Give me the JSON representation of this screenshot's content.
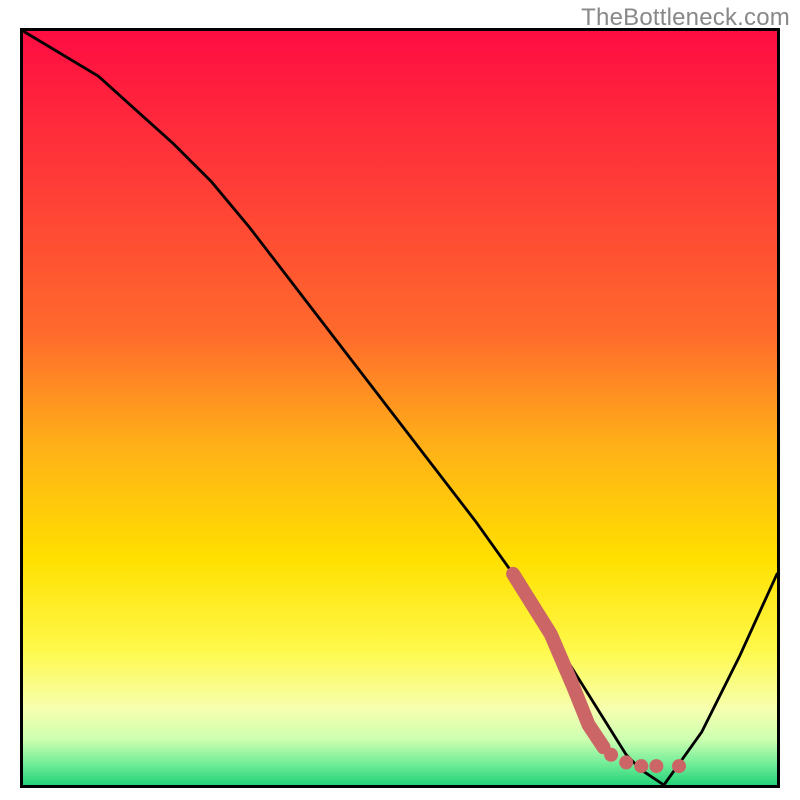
{
  "watermark": "TheBottleneck.com",
  "chart_data": {
    "type": "line",
    "title": "",
    "xlabel": "",
    "ylabel": "",
    "xlim": [
      0,
      100
    ],
    "ylim": [
      0,
      100
    ],
    "grid": false,
    "legend": false,
    "series": [
      {
        "name": "curve",
        "kind": "line",
        "color": "#000000",
        "x": [
          0,
          10,
          20,
          25,
          30,
          40,
          50,
          60,
          65,
          70,
          75,
          80,
          82,
          85,
          90,
          95,
          100
        ],
        "values": [
          100,
          94,
          85,
          80,
          74,
          61,
          48,
          35,
          28,
          20,
          12,
          4,
          2,
          0,
          7,
          17,
          28
        ]
      },
      {
        "name": "marker-segment",
        "kind": "thick-line",
        "color": "#cc6666",
        "x": [
          65,
          70,
          73,
          75,
          77
        ],
        "values": [
          28,
          20,
          13,
          8,
          5
        ]
      },
      {
        "name": "marker-dots",
        "kind": "dots",
        "color": "#cc6666",
        "x": [
          78,
          80,
          82,
          84,
          87
        ],
        "values": [
          4,
          3,
          2.5,
          2.5,
          2.5
        ]
      }
    ],
    "gradient_annotation": {
      "description": "vertical gradient fill inside plot area",
      "stops": [
        {
          "pos": 0.0,
          "color": "#ff0d42"
        },
        {
          "pos": 0.4,
          "color": "#ff6a2c"
        },
        {
          "pos": 0.55,
          "color": "#ffb018"
        },
        {
          "pos": 0.7,
          "color": "#ffe000"
        },
        {
          "pos": 0.82,
          "color": "#fff94a"
        },
        {
          "pos": 0.9,
          "color": "#f6ffb0"
        },
        {
          "pos": 0.94,
          "color": "#ccffb0"
        },
        {
          "pos": 0.97,
          "color": "#77ee99"
        },
        {
          "pos": 1.0,
          "color": "#24d37a"
        }
      ]
    }
  }
}
